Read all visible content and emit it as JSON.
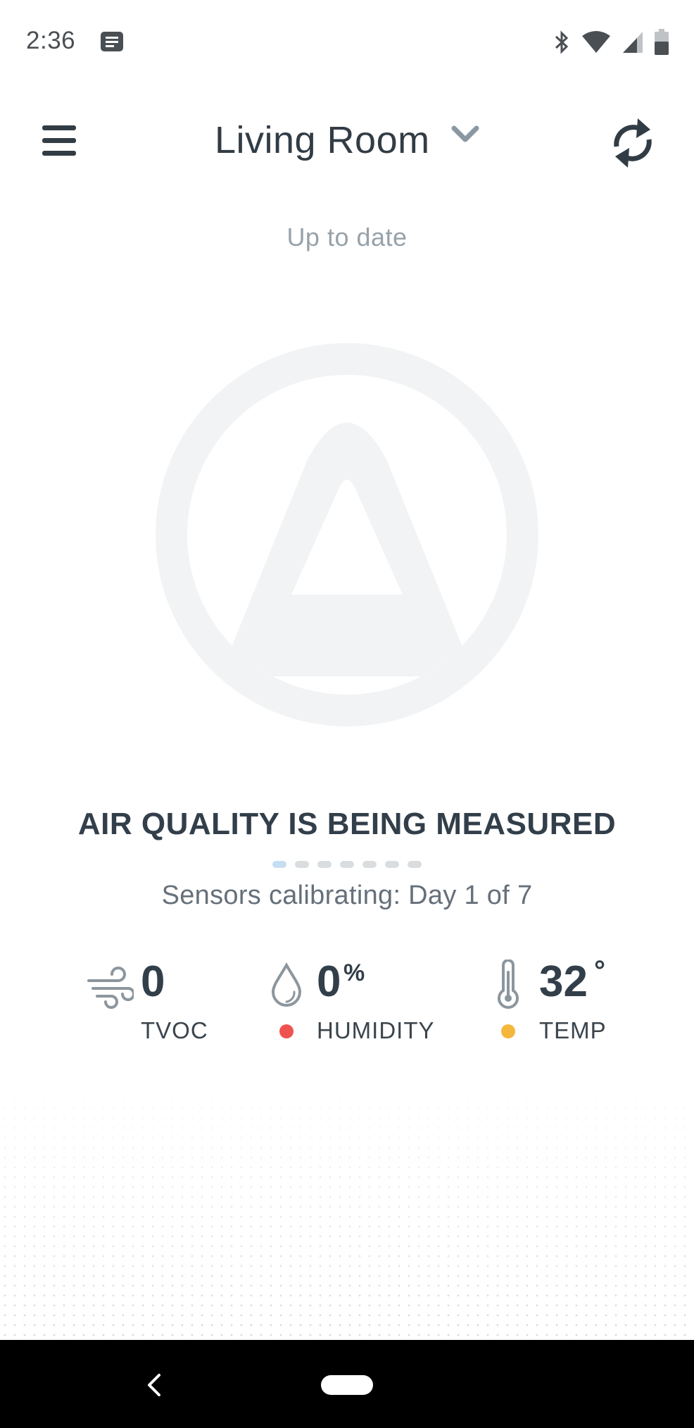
{
  "status_bar": {
    "time": "2:36",
    "icons": [
      "message-notification-icon",
      "bluetooth-icon",
      "wifi-icon",
      "cellular-signal-icon",
      "battery-icon"
    ]
  },
  "header": {
    "room_name": "Living Room",
    "menu_icon": "hamburger-menu-icon",
    "dropdown_icon": "chevron-down-icon",
    "refresh_icon": "refresh-icon"
  },
  "sync_status": "Up to date",
  "air_quality": {
    "title": "AIR QUALITY IS BEING MEASURED",
    "progress_dots_total": 7,
    "progress_dots_active": 1,
    "calibration_text": "Sensors calibrating: Day 1 of 7"
  },
  "metrics": {
    "tvoc": {
      "value": "0",
      "label": "TVOC",
      "icon": "wind-icon"
    },
    "humidity": {
      "value": "0",
      "unit": "%",
      "label": "HUMIDITY",
      "icon": "water-drop-icon",
      "indicator_color": "#ef5350"
    },
    "temp": {
      "value": "32",
      "unit": "°",
      "label": "TEMP",
      "icon": "thermometer-icon",
      "indicator_color": "#f5b73b"
    }
  },
  "colors": {
    "text_dark": "#323f4a",
    "text_muted": "#97a2aa",
    "logo_gray": "#f1f3f4",
    "dot_active": "#c6def2",
    "dot_inactive": "#d9dde0"
  },
  "nav_bar": {
    "back_icon": "back-arrow-icon",
    "home_icon": "home-pill-icon"
  }
}
